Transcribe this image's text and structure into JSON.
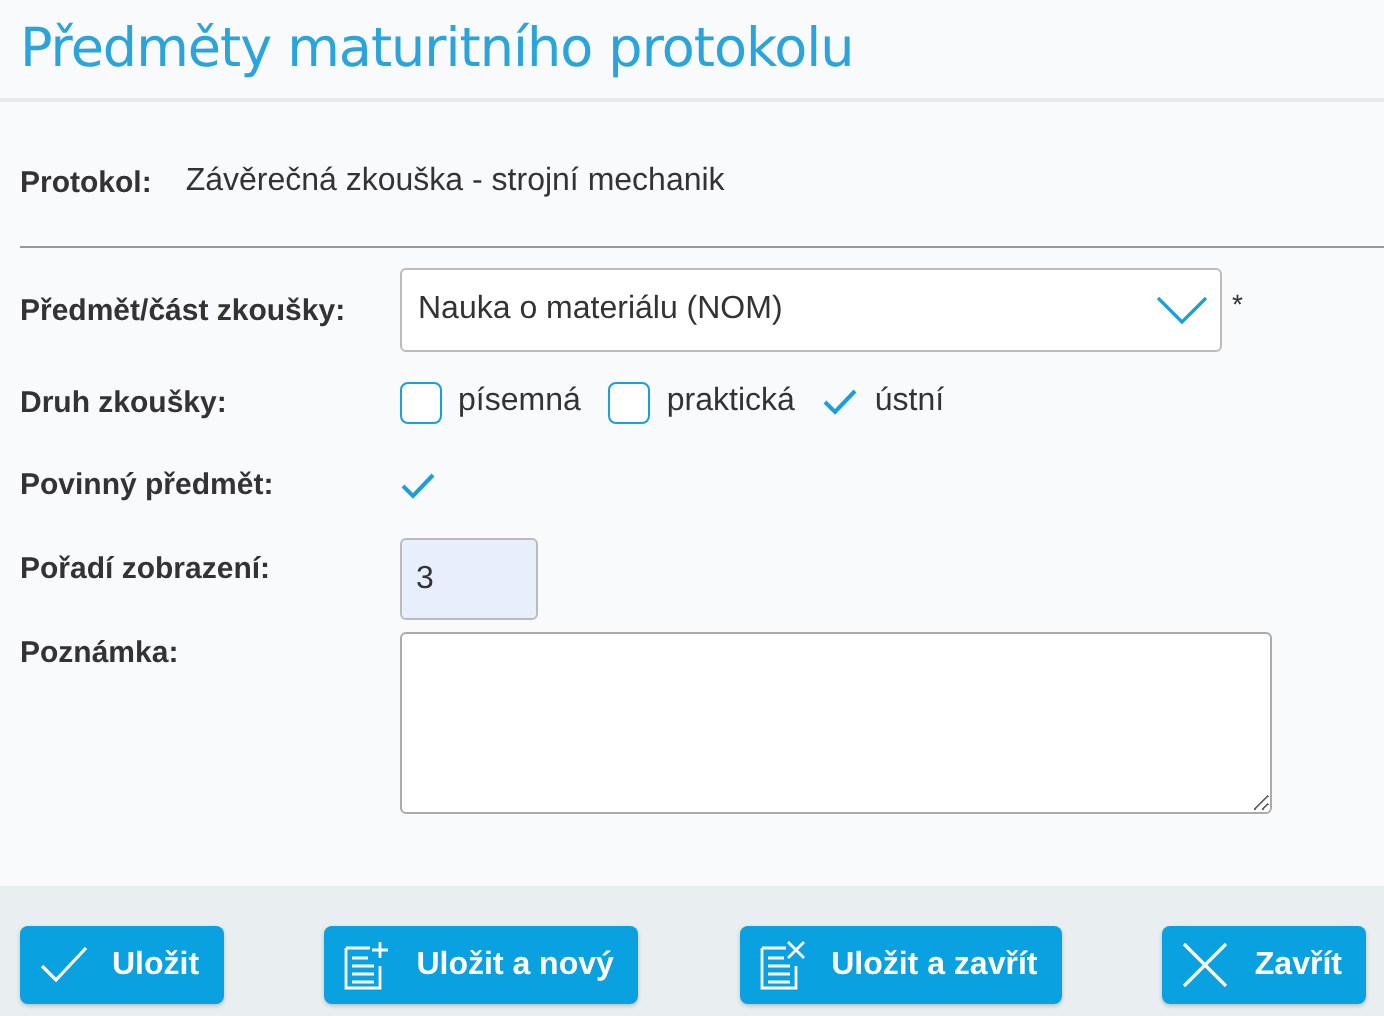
{
  "title": "Předměty maturitního protokolu",
  "protocol": {
    "label": "Protokol:",
    "value": "Závěrečná zkouška - strojní mechanik"
  },
  "fields": [
    {
      "kind": "select",
      "label": "Předmět/část zkoušky:",
      "value": "Nauka o materiálu (NOM)",
      "required_mark": "*"
    },
    {
      "kind": "checks",
      "label": "Druh zkoušky:",
      "options": [
        {
          "label": "písemná",
          "checked": false
        },
        {
          "label": "praktická",
          "checked": false
        },
        {
          "label": "ústní",
          "checked": true
        }
      ]
    },
    {
      "kind": "check",
      "label": "Povinný předmět:",
      "checked": true
    },
    {
      "kind": "input",
      "label": "Pořadí zobrazení:",
      "value": "3"
    },
    {
      "kind": "textarea",
      "label": "Poznámka:"
    }
  ],
  "buttons": [
    {
      "label": "Uložit",
      "kind": "save"
    },
    {
      "label": "Uložit a nový",
      "kind": "save_new"
    },
    {
      "label": "Uložit a zavřít",
      "kind": "save_close"
    },
    {
      "label": "Zavřít",
      "kind": "close"
    }
  ]
}
